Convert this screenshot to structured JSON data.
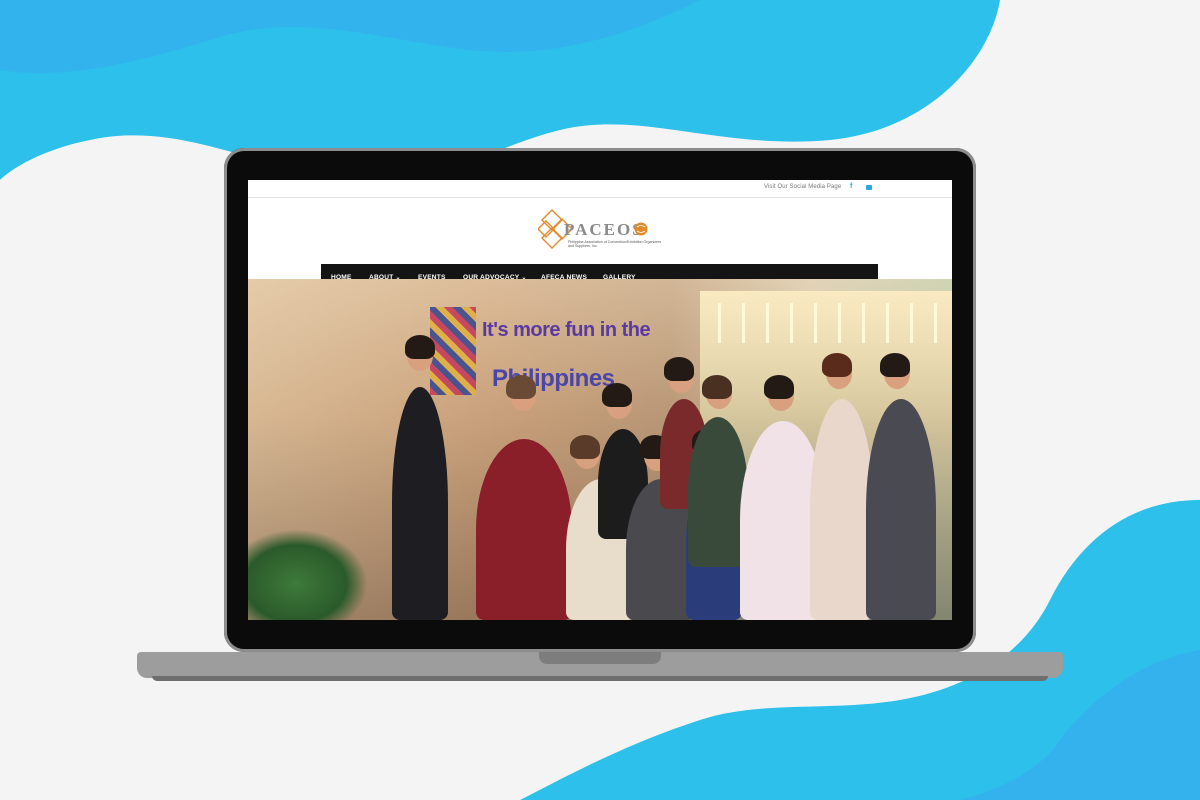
{
  "colors": {
    "accent": "#2aa9e0",
    "nav_bg": "#141414",
    "brand_gray": "#8a8a8a",
    "logo_orange": "#e08a2a"
  },
  "topbar": {
    "social_text": "Visit Our Social Media Page",
    "facebook_icon": "facebook-icon",
    "email_icon": "envelope-icon"
  },
  "logo": {
    "brand": "PACEOS",
    "tagline": "Philippine Association of Convention/Exhibition Organizers and Suppliers, Inc."
  },
  "nav": {
    "items": [
      {
        "label": "HOME",
        "dropdown": false
      },
      {
        "label": "ABOUT",
        "dropdown": true
      },
      {
        "label": "EVENTS",
        "dropdown": false
      },
      {
        "label": "OUR ADVOCACY",
        "dropdown": true
      },
      {
        "label": "AFECA NEWS",
        "dropdown": false
      },
      {
        "label": "GALLERY",
        "dropdown": false
      }
    ],
    "chevron": "⌄"
  },
  "hero": {
    "slogan_line1": "It's more fun in the",
    "slogan_line2": "Philippines"
  }
}
